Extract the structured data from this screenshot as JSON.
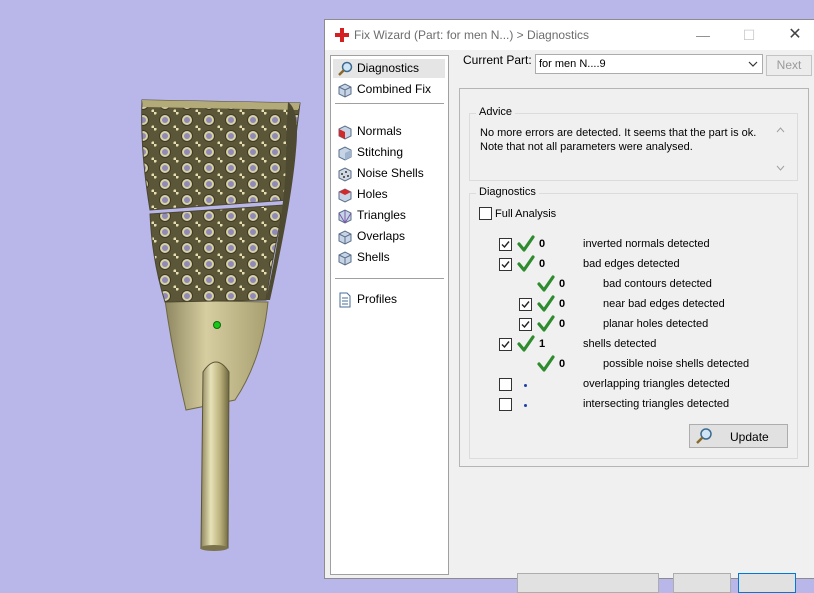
{
  "window": {
    "title": "Fix Wizard (Part: for men N...) > Diagnostics",
    "minimize_glyph": "—",
    "maximize_glyph": "☐",
    "close_glyph": "✕"
  },
  "nav": {
    "items": [
      {
        "label": "Diagnostics",
        "icon": "magnifier-icon",
        "selected": true
      },
      {
        "label": "Combined Fix",
        "icon": "cube-icon"
      },
      {
        "label": "Normals",
        "icon": "normals-cube-icon"
      },
      {
        "label": "Stitching",
        "icon": "stitching-cube-icon"
      },
      {
        "label": "Noise Shells",
        "icon": "noise-shells-icon"
      },
      {
        "label": "Holes",
        "icon": "holes-cube-icon"
      },
      {
        "label": "Triangles",
        "icon": "triangles-cube-icon"
      },
      {
        "label": "Overlaps",
        "icon": "overlaps-cube-icon"
      },
      {
        "label": "Shells",
        "icon": "shells-cube-icon"
      },
      {
        "label": "Profiles",
        "icon": "document-icon"
      }
    ]
  },
  "current_part": {
    "label": "Current Part:",
    "value": "for men N....9",
    "next_label": "Next"
  },
  "advice": {
    "legend": "Advice",
    "text_line1": "No more errors are detected. It seems that the part is ok.",
    "text_line2": "Note that not all parameters were analysed."
  },
  "diagnostics": {
    "legend": "Diagnostics",
    "full_analysis_label": "Full Analysis",
    "full_analysis_checked": false,
    "rows": [
      {
        "label": "inverted normals detected",
        "count": "0",
        "status": "ok",
        "checkbox": true,
        "checked": true,
        "indent": 0
      },
      {
        "label": "bad edges detected",
        "count": "0",
        "status": "ok",
        "checkbox": true,
        "checked": true,
        "indent": 0
      },
      {
        "label": "bad contours detected",
        "count": "0",
        "status": "ok",
        "checkbox": false,
        "indent": 1
      },
      {
        "label": "near bad edges detected",
        "count": "0",
        "status": "ok",
        "checkbox": true,
        "checked": true,
        "indent": 1
      },
      {
        "label": "planar holes detected",
        "count": "0",
        "status": "ok",
        "checkbox": true,
        "checked": true,
        "indent": 1
      },
      {
        "label": "shells detected",
        "count": "1",
        "status": "ok",
        "checkbox": true,
        "checked": true,
        "indent": 0
      },
      {
        "label": "possible noise shells detected",
        "count": "0",
        "status": "ok",
        "checkbox": false,
        "indent": 1
      },
      {
        "label": "overlapping triangles detected",
        "count": "",
        "status": "not-analysed",
        "checkbox": true,
        "checked": false,
        "indent": 0
      },
      {
        "label": "intersecting triangles detected",
        "count": "",
        "status": "not-analysed",
        "checkbox": true,
        "checked": false,
        "indent": 0
      }
    ],
    "update_label": "Update"
  },
  "colors": {
    "viewport_background": "#b9b6ea",
    "model_gold": "#c9c08f",
    "ok_check": "#2e8b2e",
    "not_analysed_dot": "#1f3fa8",
    "title_icon_red": "#d42020"
  }
}
